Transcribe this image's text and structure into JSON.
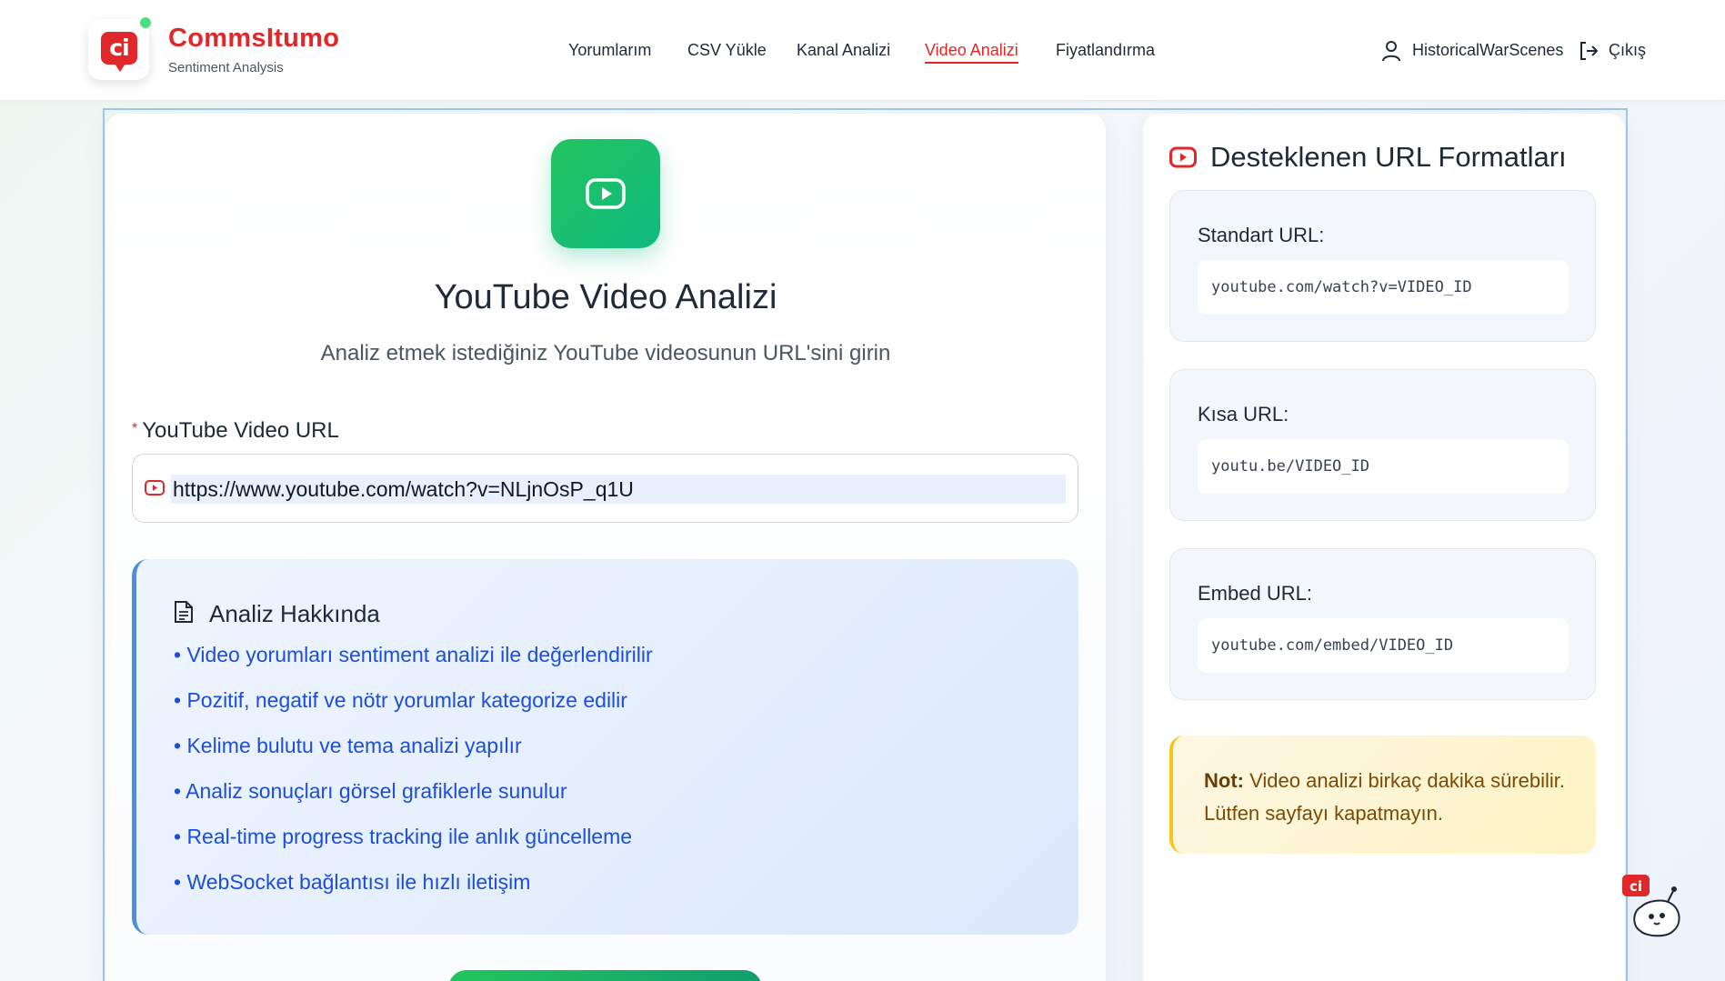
{
  "header": {
    "brand_name": "CommsItumo",
    "brand_sub": "Sentiment Analysis",
    "logo_letters": "ci",
    "nav": [
      {
        "label": "Yorumlarım",
        "active": false
      },
      {
        "label": "CSV Yükle",
        "active": false
      },
      {
        "label": "Kanal Analizi",
        "active": false
      },
      {
        "label": "Video Analizi",
        "active": true
      },
      {
        "label": "Fiyatlandırma",
        "active": false
      }
    ],
    "username": "HistoricalWarScenes",
    "logout_label": "Çıkış"
  },
  "main": {
    "title": "YouTube Video Analizi",
    "subtitle": "Analiz etmek istediğiniz YouTube videosunun URL'sini girin",
    "field_label": "YouTube Video URL",
    "required_mark": "*",
    "url_value": "https://www.youtube.com/watch?v=NLjnOsP_q1U",
    "about": {
      "title": "Analiz Hakkında",
      "items": [
        "• Video yorumları sentiment analizi ile değerlendirilir",
        "• Pozitif, negatif ve nötr yorumlar kategorize edilir",
        "• Kelime bulutu ve tema analizi yapılır",
        "• Analiz sonuçları görsel grafiklerle sunulur",
        "• Real-time progress tracking ile anlık güncelleme",
        "• WebSocket bağlantısı ile hızlı iletişim"
      ]
    }
  },
  "sidebar": {
    "title": "Desteklenen URL Formatları",
    "formats": [
      {
        "label": "Standart URL:",
        "example": "youtube.com/watch?v=VIDEO_ID"
      },
      {
        "label": "Kısa URL:",
        "example": "youtu.be/VIDEO_ID"
      },
      {
        "label": "Embed URL:",
        "example": "youtube.com/embed/VIDEO_ID"
      }
    ],
    "note_label": "Not:",
    "note_text": " Video analizi birkaç dakika sürebilir. Lütfen sayfayı kapatmayın."
  },
  "colors": {
    "brand_red": "#e0282b",
    "accent_green": "#22c55e",
    "link_blue": "#1d4ed8",
    "note_yellow": "#fdf3c4"
  },
  "icons": {
    "logo": "ci-chat-bubble-logo",
    "user": "user-icon",
    "logout": "logout-icon",
    "youtube": "youtube-play-icon",
    "document": "document-icon",
    "mascot": "mascot-icon"
  }
}
